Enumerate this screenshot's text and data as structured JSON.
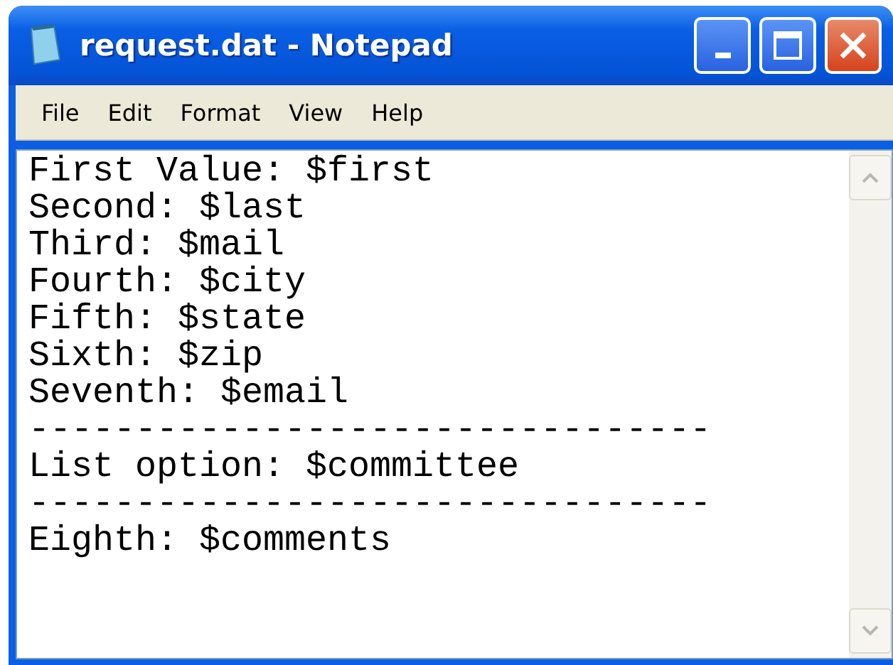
{
  "window": {
    "title": "request.dat - Notepad"
  },
  "menu": [
    "File",
    "Edit",
    "Format",
    "View",
    "Help"
  ],
  "editor": {
    "lines": [
      "First Value: $first",
      "Second: $last",
      "Third: $mail",
      "Fourth: $city",
      "Fifth: $state",
      "Sixth: $zip",
      "Seventh: $email",
      "--------------------------------",
      "List option: $committee",
      "--------------------------------",
      "Eighth: $comments"
    ]
  }
}
